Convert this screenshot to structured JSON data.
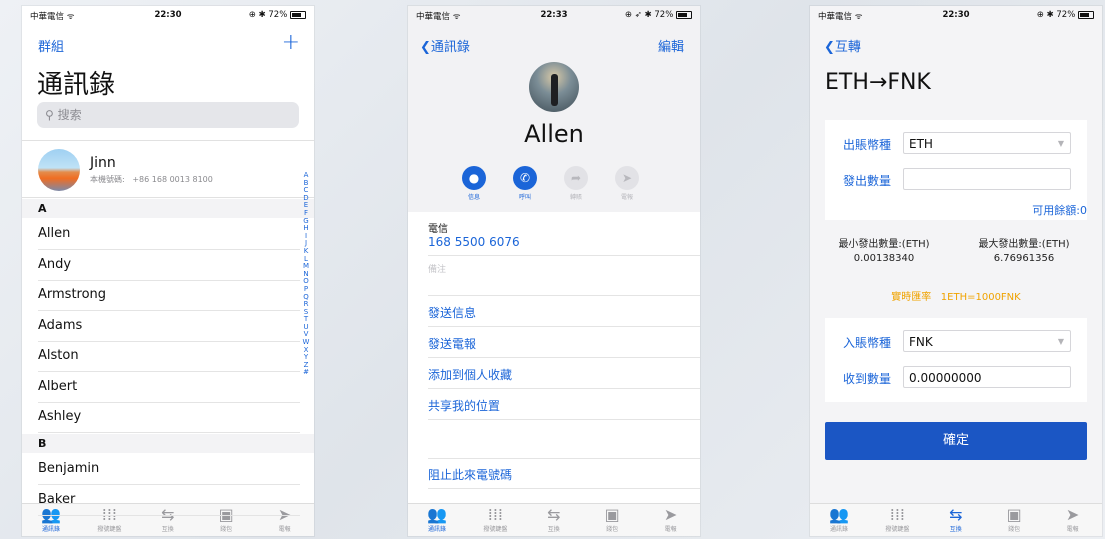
{
  "status": {
    "carrier": "中華電信",
    "battery": "72%",
    "time_1": "22:30",
    "time_2": "22:33",
    "time_3": "22:30"
  },
  "contacts": {
    "groups_label": "群組",
    "add_symbol": "+",
    "title": "通訊錄",
    "search_placeholder": "搜索",
    "my_card": {
      "name": "Jinn",
      "phone_label": "本機號碼:",
      "phone": "+86 168 0013 8100"
    },
    "section_a": "A",
    "section_b": "B",
    "rows_a": [
      "Allen",
      "Andy",
      "Armstrong",
      "Adams",
      "Alston",
      "Albert",
      "Ashley"
    ],
    "rows_b": [
      "Benjamin",
      "Baker"
    ],
    "index_letters": [
      "A",
      "B",
      "C",
      "D",
      "E",
      "F",
      "G",
      "H",
      "I",
      "J",
      "K",
      "L",
      "M",
      "N",
      "O",
      "P",
      "Q",
      "R",
      "S",
      "T",
      "U",
      "V",
      "W",
      "X",
      "Y",
      "Z",
      "#"
    ]
  },
  "detail": {
    "back_label": "通訊錄",
    "edit_label": "編輯",
    "name": "Allen",
    "actions": [
      {
        "label": "信息",
        "icon": "message-icon",
        "glyph": "●",
        "active": true
      },
      {
        "label": "呼叫",
        "icon": "phone-icon",
        "glyph": "✆",
        "active": true
      },
      {
        "label": "轉賬",
        "icon": "forward-icon",
        "glyph": "➦",
        "active": false
      },
      {
        "label": "電報",
        "icon": "send-icon",
        "glyph": "➤",
        "active": false
      }
    ],
    "phone_label": "電信",
    "phone_number": "168 5500 6076",
    "note_label": "備注",
    "send_message": "發送信息",
    "send_telegram": "發送電報",
    "add_favorite": "添加到個人收藏",
    "share_location": "共享我的位置",
    "block_caller": "阻止此來電號碼"
  },
  "exchange": {
    "back_label": "互轉",
    "title": "ETH→FNK",
    "from_label": "出賬幣種",
    "from_value": "ETH",
    "amount_label": "發出數量",
    "amount_value": "",
    "available": "可用餘額:0",
    "min_label": "最小發出數量:(ETH)",
    "min_value": "0.00138340",
    "max_label": "最大發出數量:(ETH)",
    "max_value": "6.76961356",
    "rate_label": "實時匯率",
    "rate_value": "1ETH=1000FNK",
    "to_label": "入賬幣種",
    "to_value": "FNK",
    "receive_label": "收到數量",
    "receive_value": "0.00000000",
    "confirm": "確定"
  },
  "tabbar": [
    {
      "label": "通訊錄",
      "icon": "contacts-icon",
      "glyph": "👥"
    },
    {
      "label": "撥號鍵盤",
      "icon": "keypad-icon",
      "glyph": "⁞⁞⁞"
    },
    {
      "label": "互換",
      "icon": "swap-icon",
      "glyph": "⇆"
    },
    {
      "label": "錢包",
      "icon": "wallet-icon",
      "glyph": "▣"
    },
    {
      "label": "電報",
      "icon": "telegram-icon",
      "glyph": "➤"
    }
  ],
  "colors": {
    "accent": "#1b65d8",
    "button": "#1b56c4",
    "rate": "#f0a300"
  }
}
